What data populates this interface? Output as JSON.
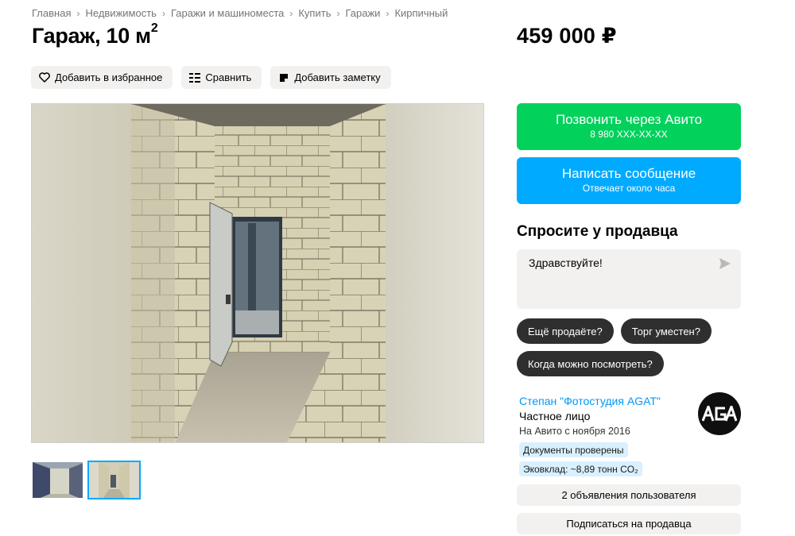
{
  "breadcrumb": [
    "Главная",
    "Недвижимость",
    "Гаражи и машиноместа",
    "Купить",
    "Гаражи",
    "Кирпичный"
  ],
  "listing": {
    "title": "Гараж, 10 м",
    "title_sup": "2",
    "price": "459 000 ₽"
  },
  "actions": {
    "favorite": "Добавить в избранное",
    "compare": "Сравнить",
    "note": "Добавить заметку"
  },
  "contact": {
    "call_label": "Позвонить через Авито",
    "call_phone": "8 980 XXX-XX-XX",
    "message_label": "Написать сообщение",
    "message_sub": "Отвечает около часа"
  },
  "ask": {
    "title": "Спросите у продавца",
    "message_value": "Здравствуйте!",
    "chips": [
      "Ещё продаёте?",
      "Торг уместен?",
      "Когда можно посмотреть?"
    ]
  },
  "seller": {
    "name": "Степан \"Фотостудия AGAT\"",
    "type": "Частное лицо",
    "since": "На Авито с ноября 2016",
    "badge_docs": "Документы проверены",
    "badge_eco": "Эковклад: ~8,89 тонн CO₂",
    "ads_button": "2 объявления пользователя",
    "subscribe_button": "Подписаться на продавца"
  },
  "colors": {
    "call": "#02d15c",
    "message": "#00aaff",
    "link": "#0099f7",
    "badge": "#d9f0ff"
  }
}
